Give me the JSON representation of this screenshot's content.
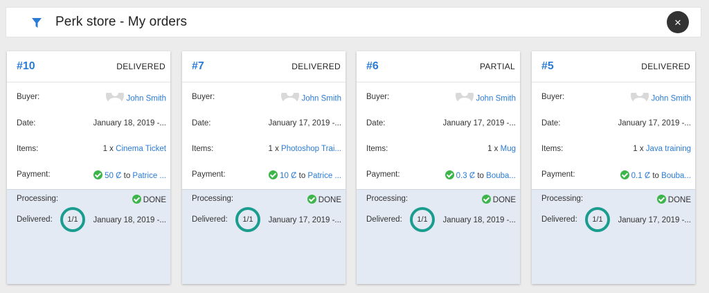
{
  "header": {
    "title": "Perk store - My orders",
    "filter_icon": "filter-icon",
    "close_label": "×",
    "close_icon": "close-icon"
  },
  "labels": {
    "buyer": "Buyer:",
    "date": "Date:",
    "items": "Items:",
    "payment": "Payment:",
    "processing": "Processing:",
    "delivered": "Delivered:"
  },
  "orders": [
    {
      "id": "#10",
      "status": "DELIVERED",
      "buyer": "John Smith",
      "date": "January 18, 2019 -...",
      "item_qty": "1 x",
      "item_name": "Cinema Ticket",
      "pay_amount": "50 Ȼ",
      "pay_to": "to",
      "pay_recipient": "Patrice ...",
      "processing": "DONE",
      "progress": "1/1",
      "delivered_date": "January 18, 2019 -..."
    },
    {
      "id": "#7",
      "status": "DELIVERED",
      "buyer": "John Smith",
      "date": "January 17, 2019 -...",
      "item_qty": "1 x",
      "item_name": "Photoshop Trai...",
      "pay_amount": "10 Ȼ",
      "pay_to": "to",
      "pay_recipient": "Patrice ...",
      "processing": "DONE",
      "progress": "1/1",
      "delivered_date": "January 17, 2019 -..."
    },
    {
      "id": "#6",
      "status": "PARTIAL",
      "buyer": "John Smith",
      "date": "January 17, 2019 -...",
      "item_qty": "1 x",
      "item_name": "Mug",
      "pay_amount": "0.3 Ȼ",
      "pay_to": "to",
      "pay_recipient": "Bouba...",
      "processing": "DONE",
      "progress": "1/1",
      "delivered_date": "January 18, 2019 -..."
    },
    {
      "id": "#5",
      "status": "DELIVERED",
      "buyer": "John Smith",
      "date": "January 17, 2019 -...",
      "item_qty": "1 x",
      "item_name": "Java training",
      "pay_amount": "0.1 Ȼ",
      "pay_to": "to",
      "pay_recipient": "Bouba...",
      "processing": "DONE",
      "progress": "1/1",
      "delivered_date": "January 17, 2019 -..."
    }
  ],
  "colors": {
    "accent": "#2a7bd6",
    "success": "#3cb54a",
    "progress_ring": "#1a9d8f",
    "bottom_panel": "#e4eaf4"
  }
}
